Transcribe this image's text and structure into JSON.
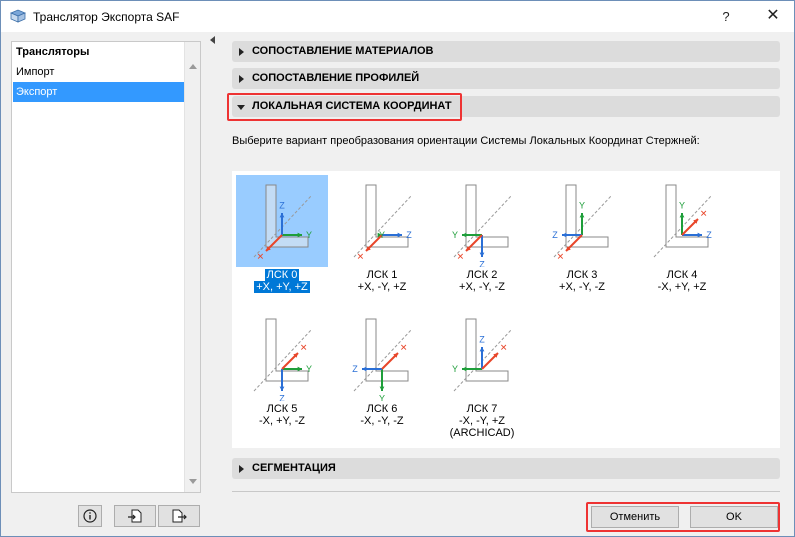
{
  "window": {
    "title": "Транслятор Экспорта SAF",
    "help_label": "?",
    "close_label": "✕"
  },
  "sidebar": {
    "items": [
      {
        "label": "Трансляторы",
        "type": "header"
      },
      {
        "label": "Импорт",
        "type": "item"
      },
      {
        "label": "Экспорт",
        "type": "selected"
      }
    ]
  },
  "sections": {
    "materials": "СОПОСТАВЛЕНИЕ МАТЕРИАЛОВ",
    "profiles": "СОПОСТАВЛЕНИЕ ПРОФИЛЕЙ",
    "lcs": "ЛОКАЛЬНАЯ СИСТЕМА КООРДИНАТ",
    "segmentation": "СЕГМЕНТАЦИЯ"
  },
  "lcs_description": "Выберите вариант преобразования ориентации Системы Локальных Координат Стержней:",
  "lcs_options": [
    {
      "name": "ЛСК 0",
      "axes": "+X, +Y, +Z",
      "note": "",
      "selected": true
    },
    {
      "name": "ЛСК 1",
      "axes": "+X, -Y, +Z",
      "note": "",
      "selected": false
    },
    {
      "name": "ЛСК 2",
      "axes": "+X, -Y, -Z",
      "note": "",
      "selected": false
    },
    {
      "name": "ЛСК 3",
      "axes": "+X, -Y, -Z",
      "note": "",
      "selected": false
    },
    {
      "name": "ЛСК 4",
      "axes": "-X, +Y, +Z",
      "note": "",
      "selected": false
    },
    {
      "name": "ЛСК 5",
      "axes": "-X, +Y, -Z",
      "note": "",
      "selected": false
    },
    {
      "name": "ЛСК 6",
      "axes": "-X, -Y, -Z",
      "note": "",
      "selected": false
    },
    {
      "name": "ЛСК 7",
      "axes": "-X, -Y, +Z",
      "note": "(ARCHICAD)",
      "selected": false
    }
  ],
  "axis_letters": {
    "y": "Y",
    "z": "Z",
    "x": "✕"
  },
  "buttons": {
    "cancel": "Отменить",
    "ok": "OK"
  },
  "colors": {
    "selection": "#3399ff",
    "thumb_selected": "#99ccff",
    "highlight": "#ee3333",
    "axis_x": "#e8462a",
    "axis_y": "#1e9e3a",
    "axis_z": "#2a6fd6"
  }
}
